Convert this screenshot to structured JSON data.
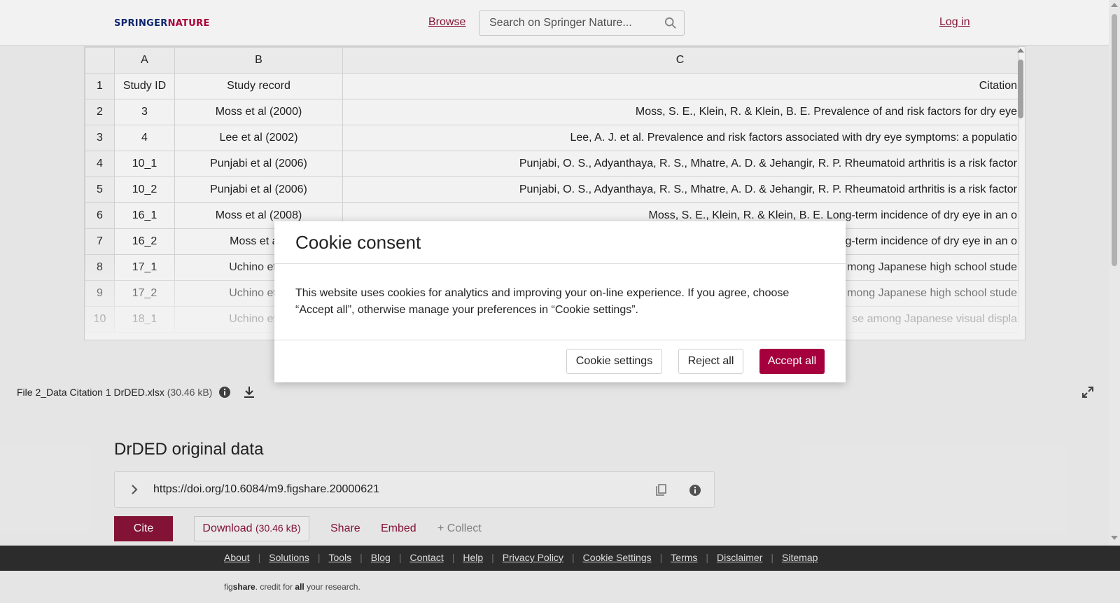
{
  "header": {
    "logo_part1": "SPRINGER",
    "logo_part2": "NATURE",
    "browse_label": "Browse",
    "search_placeholder": "Search on Springer Nature...",
    "login_label": "Log in"
  },
  "sheet": {
    "columns": [
      "A",
      "B",
      "C"
    ],
    "rows": [
      {
        "num": "1",
        "a": "Study ID",
        "b": "Study record",
        "c": "Citation"
      },
      {
        "num": "2",
        "a": "3",
        "b": "Moss et al (2000)",
        "c": "Moss, S. E., Klein, R. & Klein, B. E. Prevalence of and risk factors for dry eye"
      },
      {
        "num": "3",
        "a": "4",
        "b": "Lee et al (2002)",
        "c": "Lee, A. J. et al. Prevalence and risk factors associated with dry eye symptoms: a populatio"
      },
      {
        "num": "4",
        "a": "10_1",
        "b": "Punjabi et al (2006)",
        "c": "Punjabi, O. S., Adyanthaya, R. S., Mhatre, A. D. & Jehangir, R. P. Rheumatoid arthritis is a risk factor"
      },
      {
        "num": "5",
        "a": "10_2",
        "b": "Punjabi et al (2006)",
        "c": "Punjabi, O. S., Adyanthaya, R. S., Mhatre, A. D. & Jehangir, R. P. Rheumatoid arthritis is a risk factor"
      },
      {
        "num": "6",
        "a": "16_1",
        "b": "Moss et al (2008)",
        "c": "Moss, S. E., Klein, R. & Klein, B. E. Long-term incidence of dry eye in an o"
      },
      {
        "num": "7",
        "a": "16_2",
        "b": "Moss et al (",
        "c": "g-term incidence of dry eye in an o"
      },
      {
        "num": "8",
        "a": "17_1",
        "b": "Uchino et al",
        "c": "mong Japanese high school stude"
      },
      {
        "num": "9",
        "a": "17_2",
        "b": "Uchino et al",
        "c": "mong Japanese high school stude"
      },
      {
        "num": "10",
        "a": "18_1",
        "b": "Uchino et al",
        "c": "se among Japanese visual displa"
      }
    ]
  },
  "file": {
    "name": "File 2_Data Citation 1 DrDED.xlsx",
    "size": "(30.46 kB)"
  },
  "dataset": {
    "title": "DrDED original data",
    "doi": "https://doi.org/10.6084/m9.figshare.20000621",
    "cite_label": "Cite",
    "download_label": "Download",
    "download_size": "(30.46 kB)",
    "share_label": "Share",
    "embed_label": "Embed",
    "collect_label": "+ Collect"
  },
  "footer": {
    "links": [
      "About",
      "Solutions",
      "Tools",
      "Blog",
      "Contact",
      "Help",
      "Privacy Policy",
      "Cookie Settings",
      "Terms",
      "Disclaimer",
      "Sitemap"
    ],
    "tagline_fig": "fig",
    "tagline_share": "share",
    "tagline_mid": ". credit for ",
    "tagline_all": "all",
    "tagline_end": " your research."
  },
  "cookie": {
    "title": "Cookie consent",
    "body": "This website uses cookies for analytics and improving your on-line experience. If you agree, choose “Accept all”, otherwise manage your preferences in “Cookie settings”.",
    "settings_label": "Cookie settings",
    "reject_label": "Reject all",
    "accept_label": "Accept all"
  },
  "colors": {
    "brand": "#8a1538",
    "accept": "#a5003d",
    "logo_blue": "#0c2a73"
  }
}
